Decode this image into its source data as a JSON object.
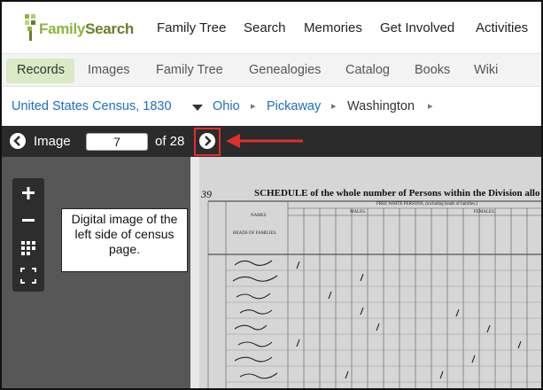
{
  "brand": {
    "name_light": "Family",
    "name_bold": "Search"
  },
  "topnav": [
    "Family Tree",
    "Search",
    "Memories",
    "Get Involved",
    "Activities"
  ],
  "subnav": {
    "active": "Records",
    "items": [
      "Images",
      "Family Tree",
      "Genealogies",
      "Catalog",
      "Books",
      "Wiki"
    ]
  },
  "breadcrumb": {
    "collection": "United States Census, 1830",
    "state": "Ohio",
    "county": "Pickaway",
    "township": "Washington"
  },
  "viewer_bar": {
    "label": "Image",
    "current": "7",
    "of_label": "of 28"
  },
  "callout": "Digital image of the left side of census page.",
  "document": {
    "page_no": "39",
    "schedule_title": "SCHEDULE of the whole number of Persons within the Division allo",
    "names_header": "NAMES",
    "heads_header": "HEADS OF FAMILIES.",
    "free_white": "FREE WHITE PERSONS, (including heads of families.)",
    "males": "MALES.",
    "females": "FEMALES."
  },
  "colors": {
    "accent": "#8cb63c",
    "link": "#1c6fbf",
    "highlight": "#e0302b",
    "toolbar": "#2b2b2b",
    "viewer": "#575757"
  },
  "icons": [
    "prev-image-icon",
    "next-image-icon",
    "zoom-in-icon",
    "zoom-out-icon",
    "grid-view-icon",
    "fullscreen-icon",
    "dropdown-caret-icon",
    "pointer-arrow-icon"
  ]
}
